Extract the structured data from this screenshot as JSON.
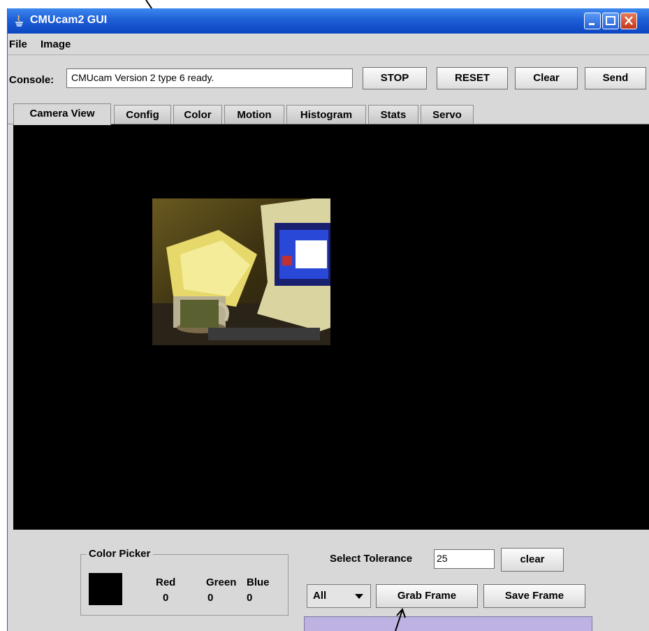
{
  "window": {
    "title": "CMUcam2 GUI"
  },
  "menu": {
    "items": [
      "File",
      "Image"
    ]
  },
  "console": {
    "label": "Console:",
    "value": "CMUcam Version 2 type 6 ready.",
    "buttons": [
      "STOP",
      "RESET",
      "Clear",
      "Send"
    ]
  },
  "tabs": [
    "Camera View",
    "Config",
    "Color",
    "Motion",
    "Histogram",
    "Stats",
    "Servo"
  ],
  "active_tab": "Camera View",
  "color_picker": {
    "title": "Color Picker",
    "swatch_color": "#000000",
    "labels": [
      "Red",
      "Green",
      "Blue"
    ],
    "values": [
      "0",
      "0",
      "0"
    ]
  },
  "tolerance": {
    "label": "Select Tolerance",
    "value": "25",
    "clear_label": "clear"
  },
  "frame_select": {
    "value": "All"
  },
  "frame_buttons": {
    "grab": "Grab Frame",
    "save": "Save Frame"
  },
  "progress": {
    "fraction": 0
  },
  "colors": {
    "titlebar": "#0b46c2",
    "progress_track": "#bdb2e2",
    "camera_bg": "#000000"
  }
}
